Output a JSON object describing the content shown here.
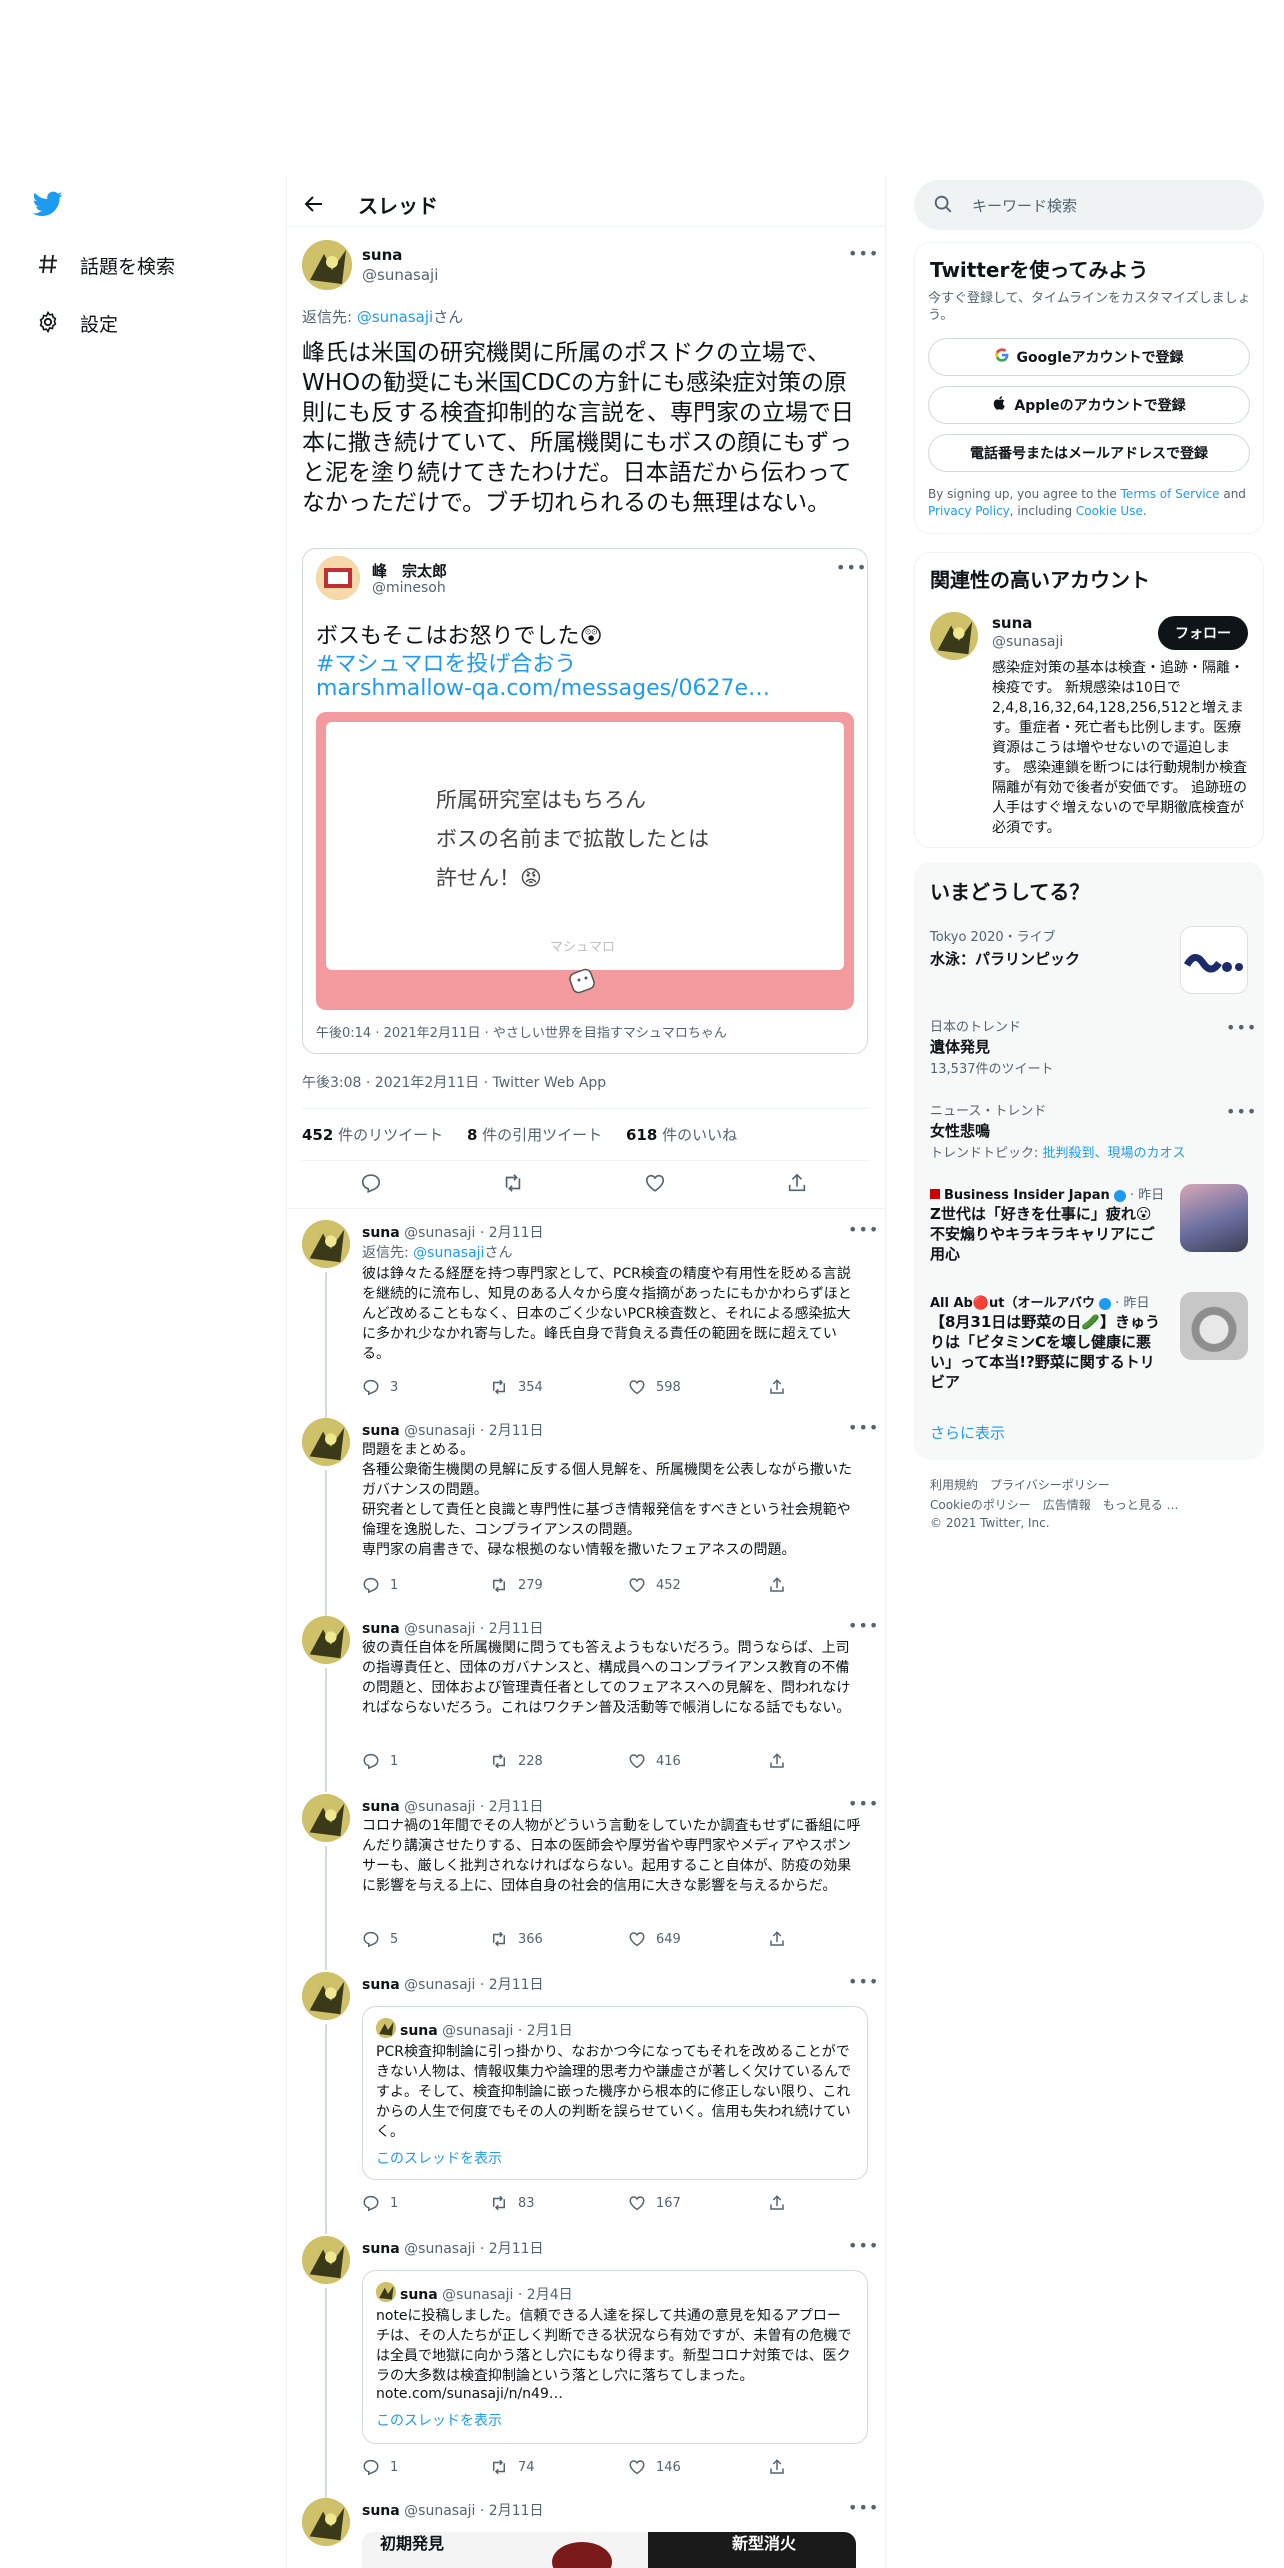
{
  "nav": {
    "explore_label": "話題を検索",
    "settings_label": "設定"
  },
  "header": {
    "title": "スレッド"
  },
  "main_tweet": {
    "name": "suna",
    "handle": "@sunasaji",
    "reply_prefix": "返信先: ",
    "reply_handle": "@sunasaji",
    "reply_suffix": "さん",
    "text": "峰氏は米国の研究機関に所属のポスドクの立場で、WHOの勧奨にも米国CDCの方針にも感染症対策の原則にも反する検査抑制的な言説を、専門家の立場で日本に撒き続けていて、所属機関にもボスの顔にもずっと泥を塗り続けてきたわけだ。日本語だから伝わってなかっただけで。ブチ切れられるのも無理はない。",
    "quote": {
      "name": "峰　宗太郎",
      "handle": "@minesoh",
      "text": "ボスもそこはお怒りでした",
      "emoji": "😲",
      "hashtag": "#マシュマロを投げ合おう",
      "link": "marshmallow-qa.com/messages/0627e…",
      "card_lines": [
        "所属研究室はもちろん",
        "ボスの名前まで拡散したとは",
        "許せん！😡"
      ],
      "card_brand": "マシュマロ",
      "meta": "午後0:14 · 2021年2月11日 · やさしい世界を目指すマシュマロちゃん"
    },
    "timestamp": "午後3:08 · 2021年2月11日 · Twitter Web App",
    "stats": {
      "retweets": "452",
      "retweets_label": " 件のリツイート",
      "quotes": "8",
      "quotes_label": " 件の引用ツイート",
      "likes": "618",
      "likes_label": " 件のいいね"
    }
  },
  "replies": [
    {
      "name": "suna",
      "handle": "@sunasaji",
      "date": "· 2月11日",
      "reply_prefix": "返信先: ",
      "reply_handle": "@sunasaji",
      "reply_suffix": "さん",
      "text": "彼は錚々たる経歴を持つ専門家として、PCR検査の精度や有用性を貶める言説を継続的に流布し、知見のある人々から度々指摘があったにもかかわらずほとんど改めることもなく、日本のごく少ないPCR検査数と、それによる感染拡大に多かれ少なかれ寄与した。峰氏自身で背負える責任の範囲を既に超えている。",
      "replies": "3",
      "retweets": "354",
      "likes": "598"
    },
    {
      "name": "suna",
      "handle": "@sunasaji",
      "date": "· 2月11日",
      "text": "問題をまとめる。\n各種公衆衛生機関の見解に反する個人見解を、所属機関を公表しながら撒いたガバナンスの問題。\n研究者として責任と良識と専門性に基づき情報発信をすべきという社会規範や倫理を逸脱した、コンプライアンスの問題。\n専門家の肩書きで、碌な根拠のない情報を撒いたフェアネスの問題。",
      "replies": "1",
      "retweets": "279",
      "likes": "452"
    },
    {
      "name": "suna",
      "handle": "@sunasaji",
      "date": "· 2月11日",
      "text": "彼の責任自体を所属機関に問うても答えようもないだろう。問うならば、上司の指導責任と、団体のガバナンスと、構成員へのコンプライアンス教育の不備の問題と、団体および管理責任者としてのフェアネスへの見解を、問われなければならないだろう。これはワクチン普及活動等で帳消しになる話でもない。",
      "replies": "1",
      "retweets": "228",
      "likes": "416"
    },
    {
      "name": "suna",
      "handle": "@sunasaji",
      "date": "· 2月11日",
      "text": "コロナ禍の1年間でその人物がどういう言動をしていたか調査もせずに番組に呼んだり講演させたりする、日本の医師会や厚労省や専門家やメディアやスポンサーも、厳しく批判されなければならない。起用すること自体が、防疫の効果に影響を与える上に、団体自身の社会的信用に大きな影響を与えるからだ。",
      "replies": "5",
      "retweets": "366",
      "likes": "649"
    },
    {
      "name": "suna",
      "handle": "@sunasaji",
      "date": "· 2月11日",
      "quote": {
        "name": "suna",
        "handle": "@sunasaji",
        "date": "· 2月1日",
        "text": "PCR検査抑制論に引っ掛かり、なおかつ今になってもそれを改めることができない人物は、情報収集力や論理的思考力や謙虚さが著しく欠けているんですよ。そして、検査抑制論に嵌った機序から根本的に修正しない限り、これからの人生で何度でもその人の判断を誤らせていく。信用も失われ続けていく。",
        "show_thread": "このスレッドを表示"
      },
      "replies": "1",
      "retweets": "83",
      "likes": "167"
    },
    {
      "name": "suna",
      "handle": "@sunasaji",
      "date": "· 2月11日",
      "quote": {
        "name": "suna",
        "handle": "@sunasaji",
        "date": "· 2月4日",
        "text": "noteに投稿しました。信頼できる人達を探して共通の意見を知るアプローチは、その人たちが正しく判断できる状況なら有効ですが、未曽有の危機では全員で地獄に向かう落とし穴にもなり得ます。新型コロナ対策では、医クラの大多数は検査抑制論という落とし穴に落ちてしまった。",
        "link": "note.com/sunasaji/n/n49…",
        "show_thread": "このスレッドを表示"
      },
      "replies": "1",
      "retweets": "74",
      "likes": "146"
    },
    {
      "name": "suna",
      "handle": "@sunasaji",
      "date": "· 2月11日",
      "newspaper_text": [
        "初期発見",
        "新型消火"
      ]
    }
  ],
  "sidebar": {
    "search_placeholder": "キーワード検索",
    "signup": {
      "title": "Twitterを使ってみよう",
      "subtitle": "今すぐ登録して、タイムラインをカスタマイズしましょう。",
      "google": "Googleアカウントで登録",
      "apple": "Appleのアカウントで登録",
      "phone": "電話番号またはメールアドレスで登録",
      "legal_1": "By signing up, you agree to the ",
      "terms": "Terms of Service",
      "legal_2": " and ",
      "privacy": "Privacy Policy",
      "legal_3": ", including ",
      "cookie": "Cookie Use",
      "legal_4": "."
    },
    "relevant": {
      "title": "関連性の高いアカウント",
      "name": "suna",
      "handle": "@sunasaji",
      "follow": "フォロー",
      "bio": "感染症対策の基本は検査・追跡・隔離・検疫です。 新規感染は10日で2,4,8,16,32,64,128,256,512と増えます。重症者・死亡者も比例します。医療資源はこうは増やせないので逼迫します。 感染連鎖を断つには行動規制か検査隔離が有効で後者が安価です。 追跡班の人手はすぐ増えないので早期徹底検査が必須です。"
    },
    "trends": {
      "title": "いまどうしてる？",
      "items": [
        {
          "context": "Tokyo 2020・ライブ",
          "title": "水泳：パラリンピック"
        },
        {
          "context": "日本のトレンド",
          "title": "遺体発見",
          "count": "13,537件のツイート"
        },
        {
          "context": "ニュース・トレンド",
          "title": "女性悲鳴",
          "topics_label": "トレンドトピック: ",
          "topics": "批判殺到、現場のカオス"
        },
        {
          "context": "Business Insider Japan",
          "time": "· 昨日",
          "title": "Z世代は「好きを仕事に」疲れ😮 不安煽りやキラキラキャリアにご用心"
        },
        {
          "context": "All Ab🔴ut（オールアバウ",
          "time": "· 昨日",
          "title": "【8月31日は野菜の日🥒】きゅうりは「ビタミンCを壊し健康に悪い」って本当!?野菜に関するトリビア"
        }
      ],
      "show_more": "さらに表示"
    },
    "footer": {
      "line1": "利用規約　プライバシーポリシー",
      "line2": "Cookieのポリシー　広告情報　もっと見る …",
      "copyright": "© 2021 Twitter, Inc."
    }
  },
  "colors": {
    "accent": "#1d9bf0",
    "text": "#0f1419",
    "muted": "#536471",
    "marshmallow": "#f29a9e"
  }
}
